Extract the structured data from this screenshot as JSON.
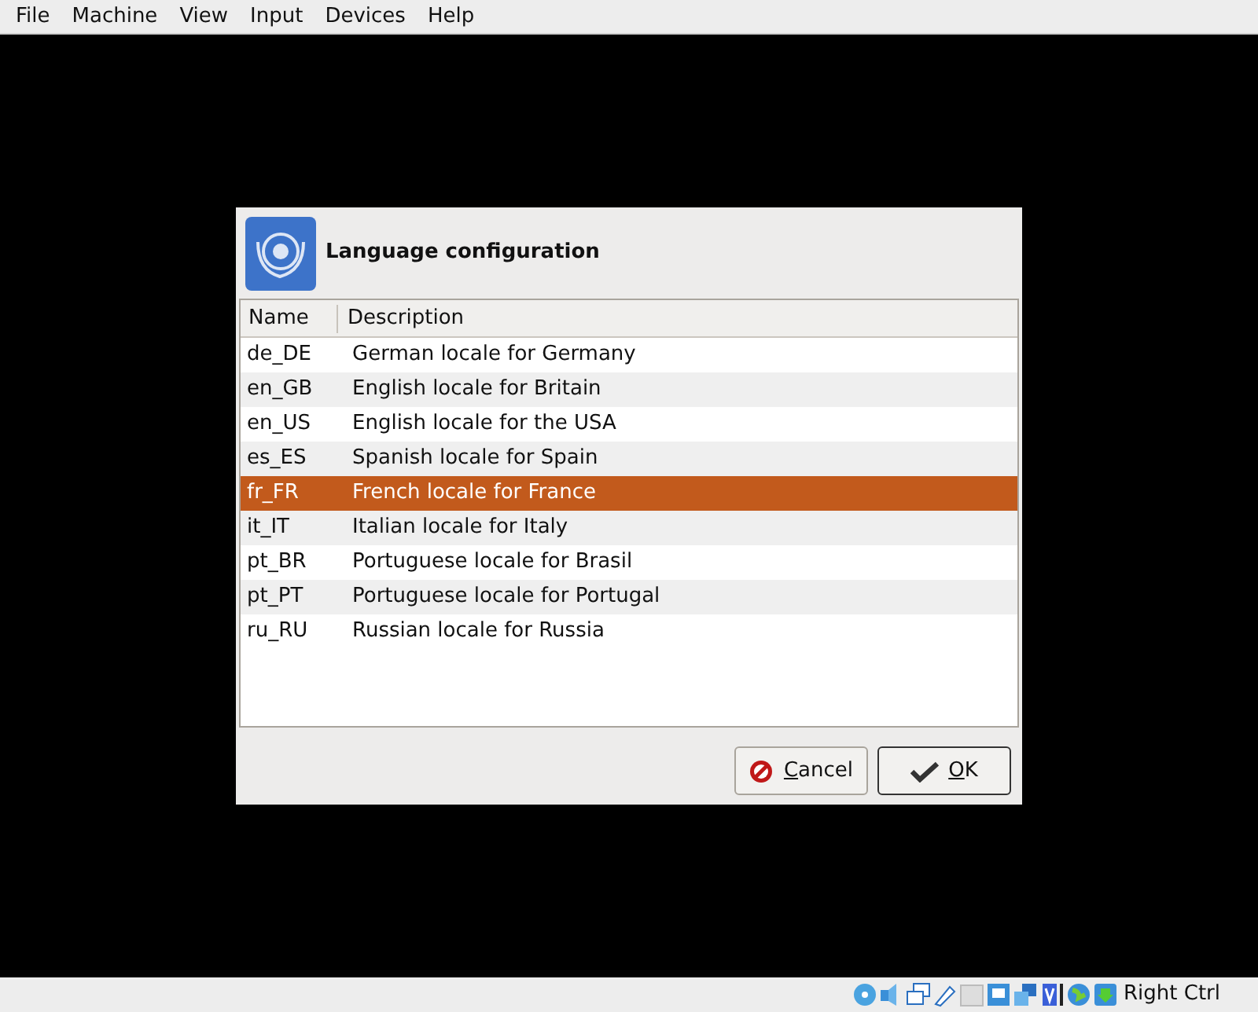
{
  "menu_bar": [
    "File",
    "Machine",
    "View",
    "Input",
    "Devices",
    "Help"
  ],
  "dialog": {
    "title": "Language configuration",
    "table": {
      "columns": [
        "Name",
        "Description"
      ],
      "rows": [
        {
          "name": "de_DE",
          "description": "German locale for Germany",
          "selected": false
        },
        {
          "name": "en_GB",
          "description": "English locale for Britain",
          "selected": false
        },
        {
          "name": "en_US",
          "description": "English locale for the USA",
          "selected": false
        },
        {
          "name": "es_ES",
          "description": "Spanish locale for Spain",
          "selected": false
        },
        {
          "name": "fr_FR",
          "description": "French locale for France",
          "selected": true
        },
        {
          "name": "it_IT",
          "description": "Italian locale for Italy",
          "selected": false
        },
        {
          "name": "pt_BR",
          "description": "Portuguese locale for Brasil",
          "selected": false
        },
        {
          "name": "pt_PT",
          "description": "Portuguese locale for Portugal",
          "selected": false
        },
        {
          "name": "ru_RU",
          "description": "Russian locale for Russia",
          "selected": false
        }
      ]
    },
    "buttons": [
      {
        "kind": "cancel",
        "label": "Cancel"
      },
      {
        "kind": "ok",
        "label": "OK"
      }
    ]
  },
  "status_bar": {
    "host_key": "Right Ctrl"
  }
}
